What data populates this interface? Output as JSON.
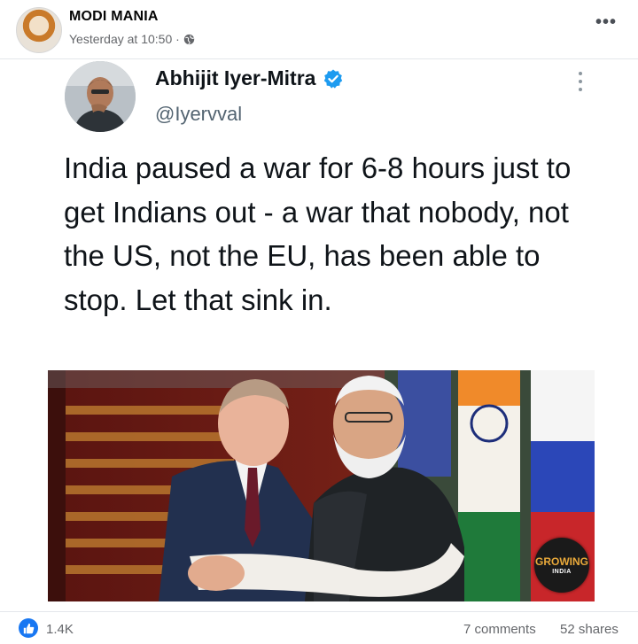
{
  "post": {
    "page_name": "MODI MANIA",
    "timestamp": "Yesterday at 10:50 ·",
    "privacy_icon": "globe-icon",
    "more_label": "•••"
  },
  "tweet": {
    "author_name": "Abhijit Iyer-Mitra",
    "handle": "@Iyervval",
    "verified_icon": "verified-badge-icon",
    "verified_color": "#1d9bf0",
    "text": "India paused a war for 6-8 hours just to get Indians out - a war that nobody, not the US, not the EU, has been able to stop. Let that sink in.",
    "image_watermark": {
      "line1": "GROWING",
      "line2": "INDIA"
    }
  },
  "reactions": {
    "like_icon": "thumbs-up-icon",
    "like_color": "#1877f2",
    "like_count": "1.4K",
    "comments": "7 comments",
    "shares": "52 shares"
  }
}
